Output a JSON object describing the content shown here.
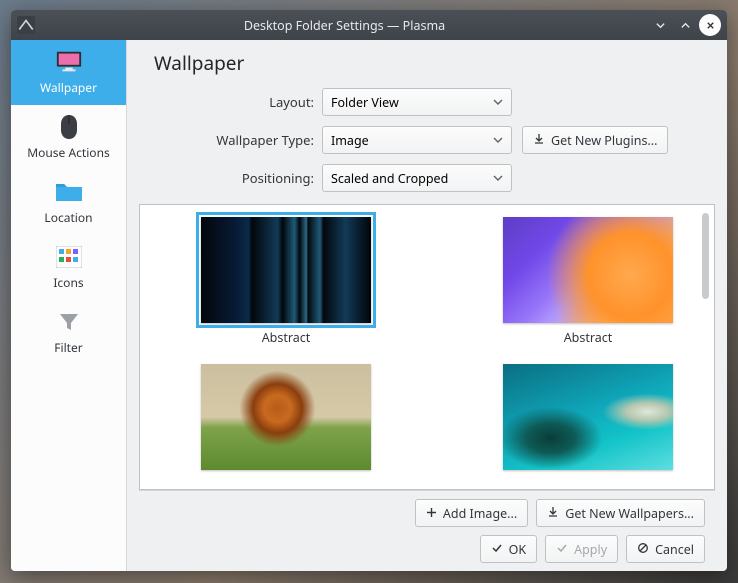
{
  "titlebar": {
    "title": "Desktop Folder Settings — Plasma"
  },
  "sidebar": {
    "items": [
      {
        "label": "Wallpaper"
      },
      {
        "label": "Mouse Actions"
      },
      {
        "label": "Location"
      },
      {
        "label": "Icons"
      },
      {
        "label": "Filter"
      }
    ]
  },
  "page": {
    "title": "Wallpaper"
  },
  "form": {
    "layout_label": "Layout:",
    "layout_value": "Folder View",
    "type_label": "Wallpaper Type:",
    "type_value": "Image",
    "positioning_label": "Positioning:",
    "positioning_value": "Scaled and Cropped",
    "get_plugins": "Get New Plugins..."
  },
  "gallery": {
    "items": [
      {
        "name": "Abstract",
        "selected": true,
        "thumb": "a"
      },
      {
        "name": "Abstract",
        "selected": false,
        "thumb": "b"
      },
      {
        "name": "",
        "selected": false,
        "thumb": "c"
      },
      {
        "name": "",
        "selected": false,
        "thumb": "d"
      }
    ]
  },
  "footer": {
    "add_image": "Add Image...",
    "get_wallpapers": "Get New Wallpapers...",
    "ok": "OK",
    "apply": "Apply",
    "cancel": "Cancel"
  },
  "icons": {
    "download": "download-icon",
    "plus": "plus-icon",
    "check": "check-icon",
    "block": "block-icon"
  }
}
